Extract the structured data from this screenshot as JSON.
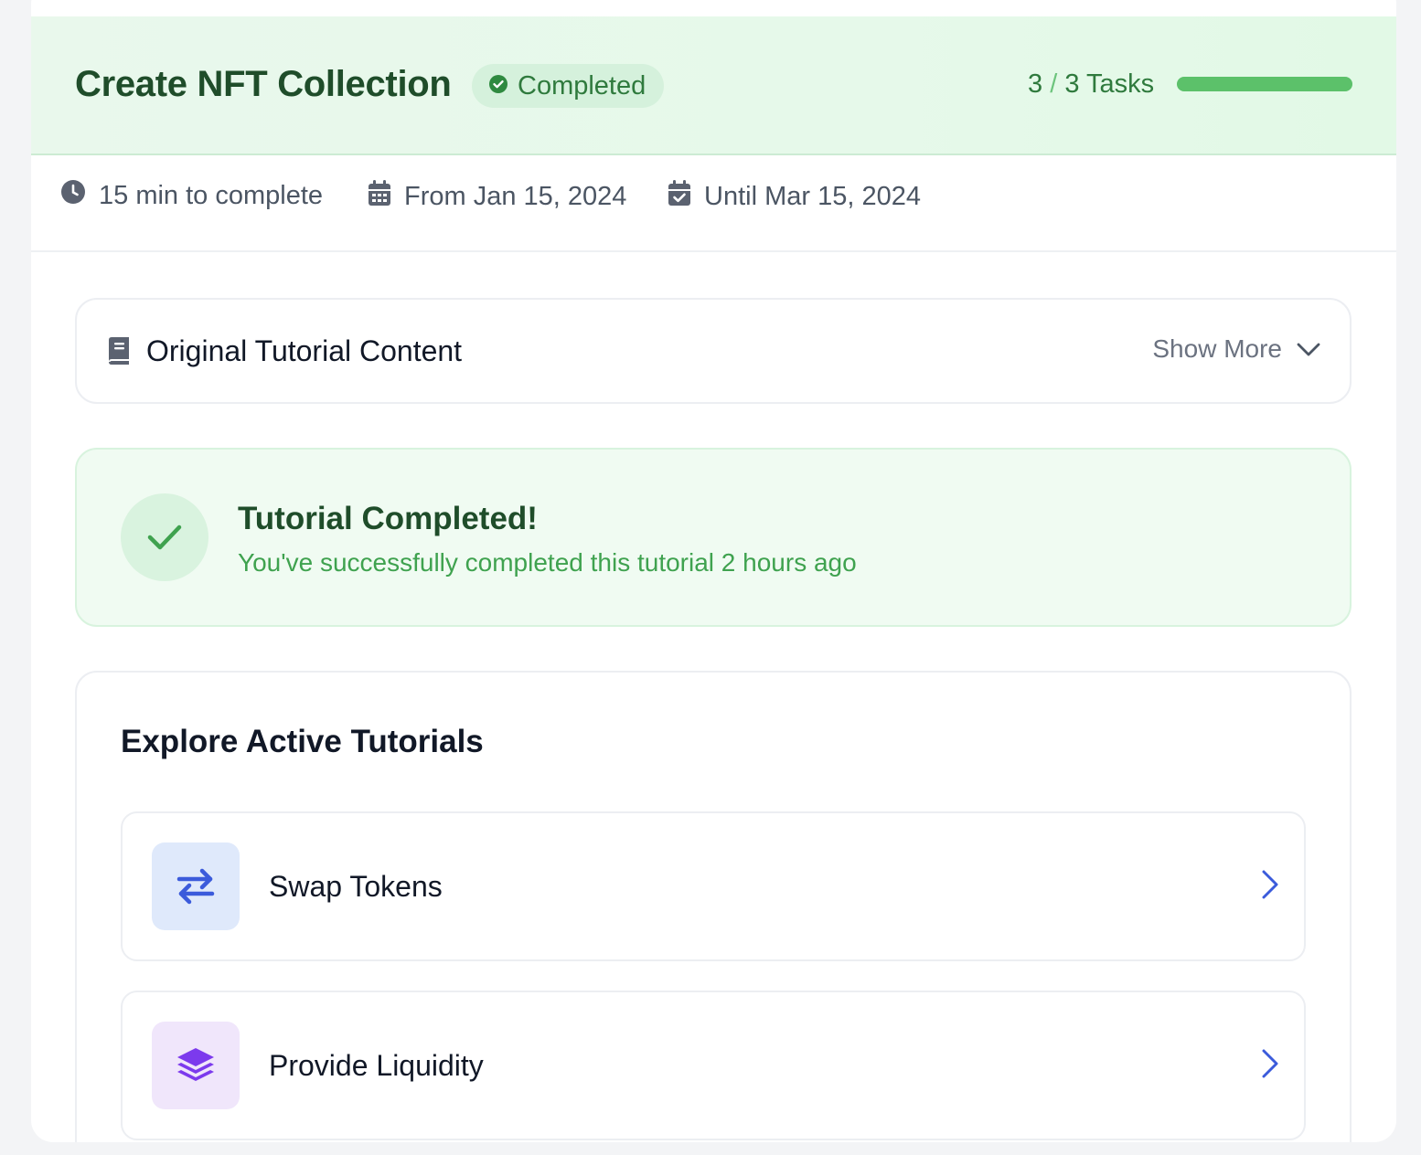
{
  "header": {
    "title": "Create NFT Collection",
    "status": "Completed",
    "tasks_done": "3",
    "tasks_sep": "/",
    "tasks_total_label": "3 Tasks",
    "progress": 1.0
  },
  "meta": {
    "duration": "15 min to complete",
    "start": "From Jan 15, 2024",
    "end": "Until Mar 15, 2024"
  },
  "original": {
    "title": "Original Tutorial Content",
    "toggle_label": "Show More"
  },
  "completion": {
    "title": "Tutorial Completed!",
    "subtitle": "You've successfully completed this tutorial 2 hours ago"
  },
  "explore": {
    "title": "Explore Active Tutorials",
    "items": [
      {
        "label": "Swap Tokens",
        "icon": "swap-arrows-icon",
        "icon_color": "#3b5bdb",
        "bg_color": "#dfe9fb"
      },
      {
        "label": "Provide Liquidity",
        "icon": "layers-icon",
        "icon_color": "#7c3aed",
        "bg_color": "#f0e6fb"
      }
    ]
  },
  "colors": {
    "accent_green": "#5cc16a",
    "title_green": "#1f4d2a",
    "link_blue": "#3b5bdb"
  }
}
